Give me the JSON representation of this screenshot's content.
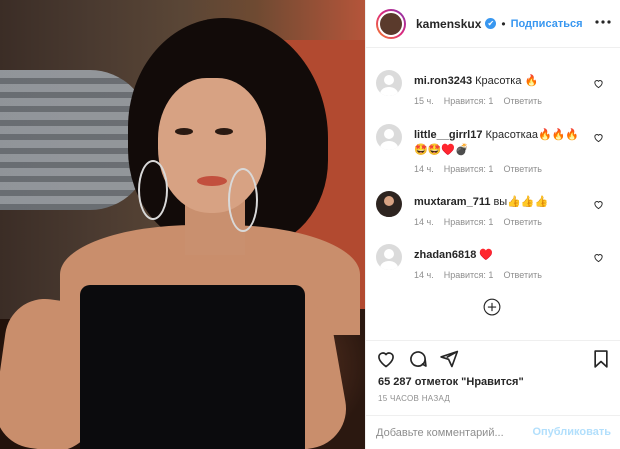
{
  "header": {
    "username": "kamenskux",
    "verified_glyph": "✔",
    "dot": "•",
    "follow_label": "Подписаться",
    "more_icon": "more-icon"
  },
  "comments": [
    {
      "user": "mi.ron3243",
      "text": "Красотка 🔥",
      "time": "15 ч.",
      "likes": "Нравится: 1",
      "reply": "Ответить",
      "avatar": "default"
    },
    {
      "user": "little__girrl17",
      "text": "Красоткаа🔥🔥🔥 🤩🤩♥️💣",
      "time": "14 ч.",
      "likes": "Нравится: 1",
      "reply": "Ответить",
      "avatar": "default"
    },
    {
      "user": "muxtaram_711",
      "text": "вы👍👍👍",
      "time": "14 ч.",
      "likes": "Нравится: 1",
      "reply": "Ответить",
      "avatar": "photo"
    },
    {
      "user": "zhadan6818",
      "text": "♥️",
      "time": "14 ч.",
      "likes": "Нравится: 1",
      "reply": "Ответить",
      "avatar": "default"
    }
  ],
  "actions": {
    "likes_text": "65 287 отметок \"Нравится\"",
    "time_ago": "15 ЧАСОВ НАЗАД"
  },
  "add_comment": {
    "placeholder": "Добавьте комментарий...",
    "publish_label": "Опубликовать"
  },
  "colors": {
    "accent": "#3897f0",
    "publish_disabled": "#b2dffc",
    "meta": "#8e8e8e"
  }
}
